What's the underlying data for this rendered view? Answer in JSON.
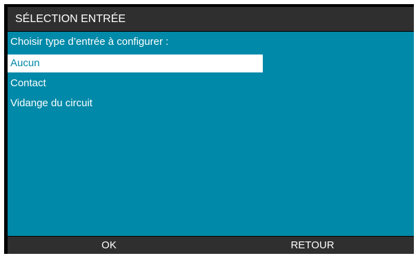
{
  "header": {
    "title": "SÉLECTION ENTRÉE"
  },
  "main": {
    "prompt": "Choisir type d’entrée à configurer :",
    "options": [
      {
        "label": "Aucun",
        "selected": true
      },
      {
        "label": "Contact",
        "selected": false
      },
      {
        "label": "Vidange du circuit",
        "selected": false
      }
    ]
  },
  "softkeys": {
    "left_label": "OK",
    "right_label": "RETOUR"
  },
  "colors": {
    "content_background": "#0089a8",
    "bar_background": "#2f2f2f",
    "frame": "#000000",
    "selection_highlight": "#ffffff"
  }
}
